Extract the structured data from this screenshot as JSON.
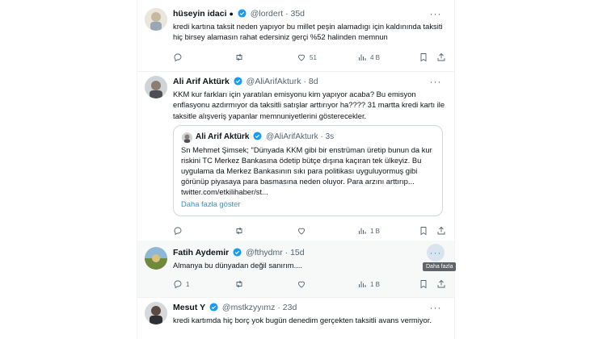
{
  "tweets": [
    {
      "name": "hüseyin idaci",
      "handle": "@lordert",
      "time": "35d",
      "text": "kredi kartına taksit neden  yapıyor bu millet peşin alamadıgı için kaldınında taksiti hiç birsey alamasın rahat edersiniz gerçi %52 halinden memnun",
      "replies": "",
      "retweets": "",
      "likes": "51",
      "views": "4 B"
    },
    {
      "name": "Ali Arif Aktürk",
      "handle": "@AliArifAkturk",
      "time": "8d",
      "text": "KKM kur farkları için yaratılan emisyonu kim yapıyor acaba? Bu emisyon enflasyonu azdırmıyor da taksitli satışlar arttırıyor ha???? 31 martta kredi kartı ile taksitle alışveriş yapanlar memnuniyetlerini gösterecekler.",
      "quote": {
        "name": "Ali Arif Aktürk",
        "handle": "@AliArifAkturk",
        "time": "3s",
        "text": "Sn Mehmet Şimsek;  \"Dünyada KKM gibi bir enstrüman üretip bunun da kur riskini TC Merkez Bankasına ödetip bütçe dışına kaçıran tek ülkeyiz. Bu uygulama da Merkez Bankasının sıkı para politikası uyguluyormuş gibi görünüp piyasaya para basmasına neden oluyor. Para arzını arttırıp... twitter.com/etkilihaber/st...",
        "link": "Daha fazla göster"
      },
      "replies": "",
      "retweets": "",
      "likes": "",
      "views": "1 B"
    },
    {
      "name": "Fatih Aydemir",
      "handle": "@fthydmr",
      "time": "15d",
      "text": "Almanya bu dünyadan değil sanırım....",
      "replies": "1",
      "retweets": "",
      "likes": "",
      "views": "1 B",
      "tooltip": "Daha fazla"
    },
    {
      "name": "Mesut Y",
      "handle": "@mstkzyyımz",
      "time": "23d",
      "text": "kredi kartımda hiç borç yok bugün denedim gerçekten taksitli avans vermiyor."
    }
  ],
  "icons": [
    "verified-badge-icon",
    "more-icon",
    "reply-icon",
    "retweet-icon",
    "like-icon",
    "views-icon",
    "bookmark-icon",
    "share-icon"
  ],
  "colors": {
    "accent": "#1d9bf0",
    "muted": "#536471",
    "border": "#eff3f4",
    "hover_bg": "#f7f9f9"
  }
}
